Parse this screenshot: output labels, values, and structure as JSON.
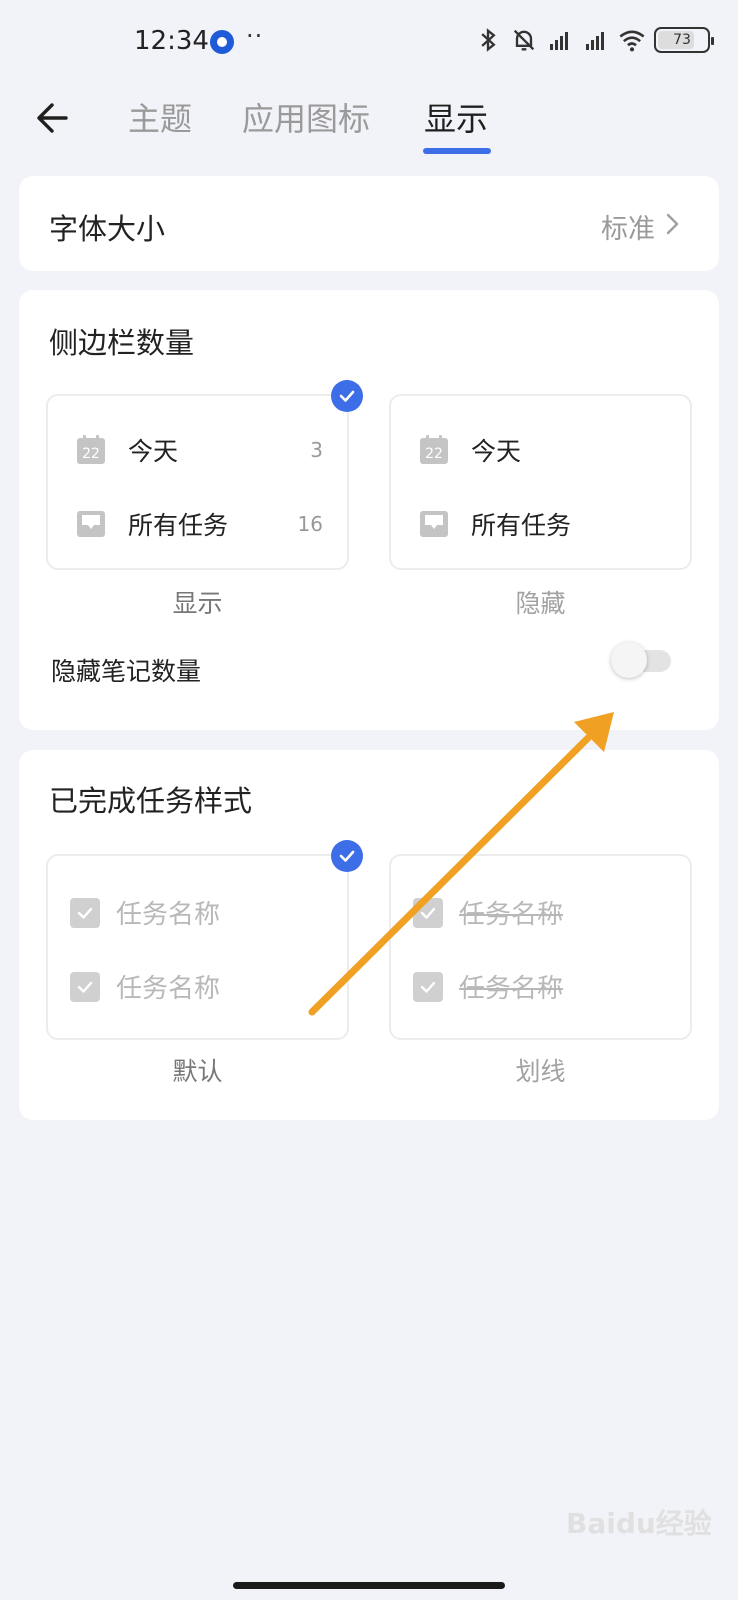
{
  "status_bar": {
    "time": "12:34",
    "dots": "··",
    "battery": "73"
  },
  "header": {
    "back_icon": "arrow-left-icon",
    "tabs": [
      {
        "label": "主题",
        "active": false
      },
      {
        "label": "应用图标",
        "active": false
      },
      {
        "label": "显示",
        "active": true
      }
    ]
  },
  "font_size": {
    "label": "字体大小",
    "value": "标准"
  },
  "sidebar_count": {
    "title": "侧边栏数量",
    "options": [
      {
        "caption": "显示",
        "selected": true,
        "rows": [
          {
            "icon": "calendar-icon",
            "icon_text": "22",
            "label": "今天",
            "count": "3"
          },
          {
            "icon": "inbox-icon",
            "label": "所有任务",
            "count": "16"
          }
        ]
      },
      {
        "caption": "隐藏",
        "selected": false,
        "rows": [
          {
            "icon": "calendar-icon",
            "icon_text": "22",
            "label": "今天"
          },
          {
            "icon": "inbox-icon",
            "label": "所有任务"
          }
        ]
      }
    ],
    "toggle_label": "隐藏笔记数量",
    "toggle_on": false
  },
  "completed_style": {
    "title": "已完成任务样式",
    "options": [
      {
        "caption": "默认",
        "selected": true,
        "rows": [
          "任务名称",
          "任务名称"
        ]
      },
      {
        "caption": "划线",
        "selected": false,
        "rows": [
          "任务名称",
          "任务名称"
        ]
      }
    ]
  },
  "colors": {
    "accent": "#3d6ee8",
    "annotation_arrow": "#f0a023",
    "background": "#f2f3f8"
  },
  "watermark": "Baidu经验"
}
